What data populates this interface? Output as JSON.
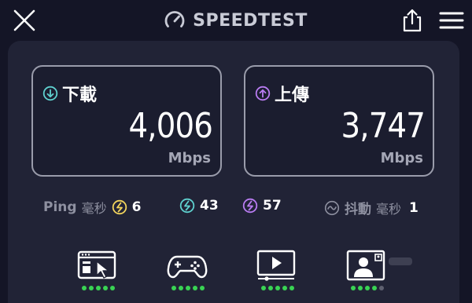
{
  "header": {
    "brand_name": "SPEEDTEST",
    "icons": {
      "close": "close-icon",
      "brand": "speedometer-icon",
      "share": "share-icon",
      "menu": "hamburger-menu-icon"
    }
  },
  "download": {
    "label": "下載",
    "value": "4,006",
    "unit": "Mbps",
    "icon": "arrow-down-circle-icon",
    "color": "#5fd1cf"
  },
  "upload": {
    "label": "上傳",
    "value": "3,747",
    "unit": "Mbps",
    "icon": "arrow-up-circle-icon",
    "color": "#b97cf2"
  },
  "ping": {
    "label": "Ping",
    "unit_label": "毫秒",
    "idle_value": "6",
    "download_value": "43",
    "upload_value": "57",
    "colors": {
      "idle": "#f2d45c",
      "download": "#5fd1cf",
      "upload": "#b97cf2"
    }
  },
  "jitter": {
    "label": "抖動",
    "unit_label": "毫秒",
    "value": "1",
    "icon": "jitter-wave-icon"
  },
  "quality": [
    {
      "name": "web-browsing",
      "icon": "browser-cursor-icon",
      "rating": 5,
      "max": 5
    },
    {
      "name": "gaming",
      "icon": "gamepad-icon",
      "rating": 5,
      "max": 5
    },
    {
      "name": "video-streaming",
      "icon": "video-play-icon",
      "rating": 5,
      "max": 5
    },
    {
      "name": "video-calling",
      "icon": "video-call-person-icon",
      "rating": 4,
      "max": 5
    }
  ],
  "colors": {
    "background": "#141526",
    "panel": "#212336",
    "good": "#39d353",
    "off": "#5e6070"
  }
}
